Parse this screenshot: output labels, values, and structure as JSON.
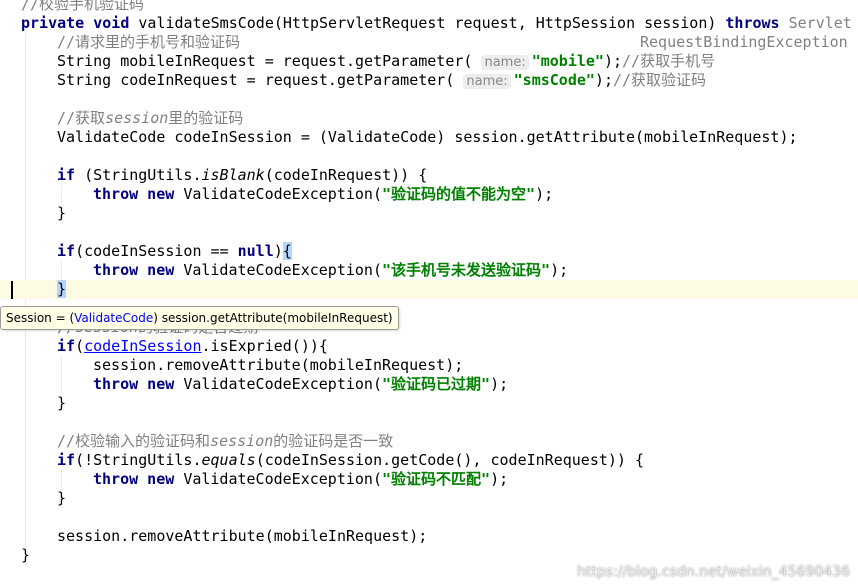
{
  "editor": {
    "highlight_line": 15,
    "lines": [
      {
        "indent": 0,
        "tokens": [
          [
            "cm",
            "//校验手机验证码"
          ]
        ]
      },
      {
        "indent": 0,
        "tokens": [
          [
            "kw",
            "private void "
          ],
          [
            "",
            "validateSmsCode(HttpServletRequest request, HttpSession session) "
          ],
          [
            "kw",
            "throws "
          ],
          [
            "cm",
            "ServletRequestBindingException"
          ]
        ]
      },
      {
        "indent": 1,
        "tokens": [
          [
            "cm",
            "//请求里的手机号和验证码"
          ]
        ]
      },
      {
        "indent": 1,
        "tokens": [
          [
            "",
            "String mobileInRequest = request.getParameter( "
          ],
          [
            "hint",
            "name:"
          ],
          [
            "str",
            "\"mobile\""
          ],
          [
            "",
            ");"
          ],
          [
            "cm",
            "//获取手机号"
          ]
        ]
      },
      {
        "indent": 1,
        "tokens": [
          [
            "",
            "String codeInRequest = request.getParameter( "
          ],
          [
            "hint",
            "name:"
          ],
          [
            "str",
            "\"smsCode\""
          ],
          [
            "",
            ");"
          ],
          [
            "cm",
            "//获取验证码"
          ]
        ]
      },
      {
        "indent": 0,
        "tokens": []
      },
      {
        "indent": 1,
        "tokens": [
          [
            "cm",
            "//获取"
          ],
          [
            "cmi",
            "session"
          ],
          [
            "cm",
            "里的验证码"
          ]
        ]
      },
      {
        "indent": 1,
        "tokens": [
          [
            "",
            "ValidateCode codeInSession = (ValidateCode) session.getAttribute(mobileInRequest);"
          ]
        ]
      },
      {
        "indent": 0,
        "tokens": []
      },
      {
        "indent": 1,
        "tokens": [
          [
            "kw",
            "if "
          ],
          [
            "",
            "(StringUtils."
          ],
          [
            "it",
            "isBlank"
          ],
          [
            "",
            "(codeInRequest)) {"
          ]
        ]
      },
      {
        "indent": 2,
        "tokens": [
          [
            "kw",
            "throw new "
          ],
          [
            "",
            "ValidateCodeException("
          ],
          [
            "str",
            "\"验证码的值不能为空\""
          ],
          [
            "",
            ");"
          ]
        ]
      },
      {
        "indent": 1,
        "tokens": [
          [
            "",
            "}"
          ]
        ]
      },
      {
        "indent": 0,
        "tokens": []
      },
      {
        "indent": 1,
        "tokens": [
          [
            "kw",
            "if"
          ],
          [
            "",
            "(codeInSession == "
          ],
          [
            "kw",
            "null"
          ],
          [
            "",
            ")"
          ],
          [
            "sel",
            "{"
          ]
        ]
      },
      {
        "indent": 2,
        "tokens": [
          [
            "kw",
            "throw new "
          ],
          [
            "",
            "ValidateCodeException("
          ],
          [
            "str",
            "\"该手机号未发送验证码\""
          ],
          [
            "",
            ");"
          ]
        ]
      },
      {
        "indent": 1,
        "tokens": [
          [
            "sel",
            "}"
          ]
        ]
      },
      {
        "indent": 0,
        "tokens": []
      },
      {
        "indent": 1,
        "tokens": [
          [
            "cm",
            "//"
          ],
          [
            "cmi",
            "session"
          ],
          [
            "cm",
            "的验证码是否过期"
          ]
        ]
      },
      {
        "indent": 1,
        "tokens": [
          [
            "kw",
            "if"
          ],
          [
            "",
            "("
          ],
          [
            "lnk",
            "codeInSession"
          ],
          [
            "",
            ".isExpried()){"
          ]
        ]
      },
      {
        "indent": 2,
        "tokens": [
          [
            "",
            "session.removeAttribute(mobileInRequest);"
          ]
        ]
      },
      {
        "indent": 2,
        "tokens": [
          [
            "kw",
            "throw new "
          ],
          [
            "",
            "ValidateCodeException("
          ],
          [
            "str",
            "\"验证码已过期\""
          ],
          [
            "",
            ");"
          ]
        ]
      },
      {
        "indent": 1,
        "tokens": [
          [
            "",
            "}"
          ]
        ]
      },
      {
        "indent": 0,
        "tokens": []
      },
      {
        "indent": 1,
        "tokens": [
          [
            "cm",
            "//校验输入的验证码和"
          ],
          [
            "cmi",
            "session"
          ],
          [
            "cm",
            "的验证码是否一致"
          ]
        ]
      },
      {
        "indent": 1,
        "tokens": [
          [
            "kw",
            "if"
          ],
          [
            "",
            "(!StringUtils."
          ],
          [
            "it",
            "equals"
          ],
          [
            "",
            "(codeInSession.getCode(), codeInRequest)) {"
          ]
        ]
      },
      {
        "indent": 2,
        "tokens": [
          [
            "kw",
            "throw new "
          ],
          [
            "",
            "ValidateCodeException("
          ],
          [
            "str",
            "\"验证码不匹配\""
          ],
          [
            "",
            ");"
          ]
        ]
      },
      {
        "indent": 1,
        "tokens": [
          [
            "",
            "}"
          ]
        ]
      },
      {
        "indent": 0,
        "tokens": []
      },
      {
        "indent": 1,
        "tokens": [
          [
            "",
            "session.removeAttribute(mobileInRequest);"
          ]
        ]
      },
      {
        "indent": 0,
        "tokens": [
          [
            "",
            "}"
          ]
        ]
      }
    ]
  },
  "tooltip": {
    "prefix": "Session = (",
    "type_link": "ValidateCode",
    "suffix": ") session.getAttribute(mobileInRequest)"
  },
  "watermark": "https://blog.csdn.net/weixin_45690436"
}
